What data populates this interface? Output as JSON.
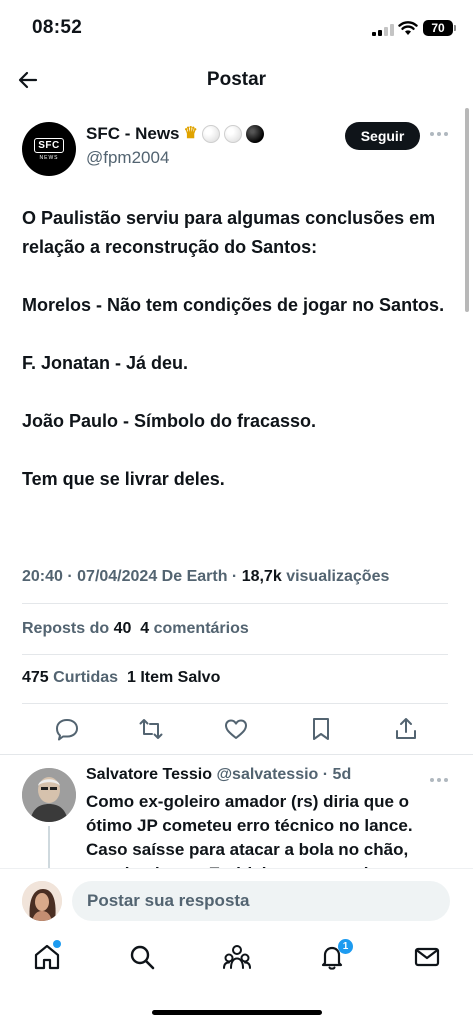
{
  "status_bar": {
    "time": "08:52",
    "battery": "70"
  },
  "header": {
    "title": "Postar"
  },
  "tweet": {
    "author_name": "SFC - News",
    "author_emojis": [
      "crown-icon",
      "white-ball-icon",
      "white-ball-icon",
      "black-ball-icon"
    ],
    "author_handle": "@fpm2004",
    "avatar_logo": "SFC",
    "avatar_sub": "NEWS",
    "follow_label": "Seguir",
    "paragraphs": [
      "O Paulistão serviu para algumas conclusões em relação a reconstrução do Santos:",
      "Morelos - Não tem condições de jogar no Santos.",
      "F. Jonatan - Já deu.",
      "João Paulo - Símbolo do fracasso.",
      "Tem que se livrar deles."
    ],
    "timestamp": "20:40 · 07/04/2024 De Earth ·",
    "views_count": "18,7k",
    "views_label": "visualizações",
    "reposts_label": "Reposts do",
    "reposts_count": "40",
    "comments_count": "4",
    "comments_label": "comentários",
    "likes_count": "475",
    "likes_label": "Curtidas",
    "saved_count": "1",
    "saved_label": "Item Salvo"
  },
  "reply": {
    "name": "Salvatore Tessio",
    "handle_time": "@salvatessio · 5d",
    "text": "Como ex-goleiro amador (rs) diria que o ótimo JP cometeu erro técnico no lance. Caso saísse para atacar a bola no chão, ensaiando, e o Endrick tocasse pelo"
  },
  "composer": {
    "placeholder": "Postar sua resposta"
  },
  "tabbar": {
    "notifications_badge": "1"
  },
  "colors": {
    "text": "#0f1419",
    "secondary": "#536471",
    "accent": "#1d9bf0",
    "divider": "#e4e7ea"
  }
}
